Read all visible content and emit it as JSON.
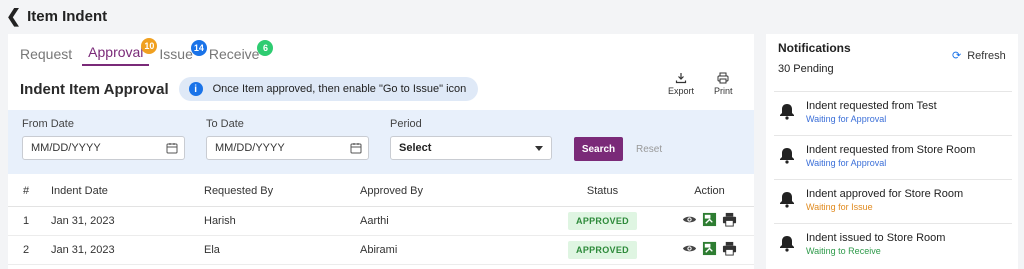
{
  "header": {
    "title": "Item Indent"
  },
  "tabs": [
    {
      "label": "Request"
    },
    {
      "label": "Approval",
      "badge": "10",
      "badge_color": "#f0a020"
    },
    {
      "label": "Issue",
      "badge": "14",
      "badge_color": "#1a73e8"
    },
    {
      "label": "Receive",
      "badge": "6",
      "badge_color": "#2ecc71"
    }
  ],
  "panel": {
    "title": "Indent Item Approval",
    "info_text": "Once Item approved, then enable \"Go to Issue\" icon",
    "export_label": "Export",
    "print_label": "Print"
  },
  "filters": {
    "from_label": "From Date",
    "from_placeholder": "MM/DD/YYYY",
    "to_label": "To Date",
    "to_placeholder": "MM/DD/YYYY",
    "period_label": "Period",
    "period_value": "Select",
    "search_label": "Search",
    "reset_label": "Reset"
  },
  "table": {
    "columns": [
      "#",
      "Indent Date",
      "Requested By",
      "Approved By",
      "Status",
      "Action"
    ],
    "rows": [
      {
        "num": "1",
        "date": "Jan 31, 2023",
        "requested": "Harish",
        "approved": "Aarthi",
        "status": "APPROVED"
      },
      {
        "num": "2",
        "date": "Jan 31, 2023",
        "requested": "Ela",
        "approved": "Abirami",
        "status": "APPROVED"
      }
    ]
  },
  "notifications": {
    "title": "Notifications",
    "pending": "30 Pending",
    "refresh_label": "Refresh",
    "items": [
      {
        "text": "Indent requested from Test",
        "sub": "Waiting for Approval",
        "sub_color": "#3b6fd8"
      },
      {
        "text": "Indent requested from Store Room",
        "sub": "Waiting for Approval",
        "sub_color": "#3b6fd8"
      },
      {
        "text": "Indent approved for Store Room",
        "sub": "Waiting for Issue",
        "sub_color": "#e08a1e"
      },
      {
        "text": "Indent issued to Store Room",
        "sub": "Waiting to Receive",
        "sub_color": "#2e9a4a"
      }
    ]
  },
  "colors": {
    "accent": "#7a2a78",
    "info_bg": "#dfe9f7",
    "filter_bg": "#e8f0fb",
    "status_bg": "#dff5e2",
    "status_text": "#2d8a3a"
  }
}
